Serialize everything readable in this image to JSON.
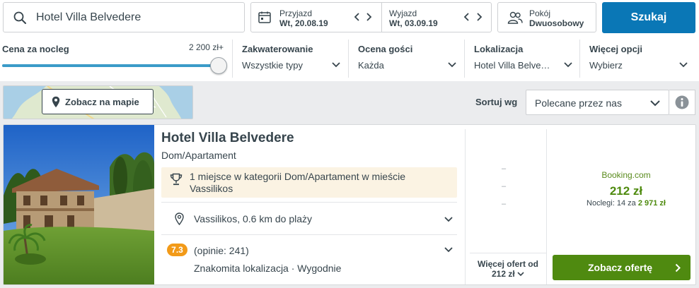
{
  "search": {
    "query": "Hotel Villa Belvedere",
    "button_label": "Szukaj",
    "icon": "search-icon"
  },
  "dates": {
    "checkin_label": "Przyjazd",
    "checkin_value": "Wt, 20.08.19",
    "checkout_label": "Wyjazd",
    "checkout_value": "Wt, 03.09.19"
  },
  "rooms": {
    "label": "Pokój",
    "value": "Dwuosobowy"
  },
  "filters": {
    "price": {
      "title": "Cena za nocleg",
      "max_label": "2 200 zł+",
      "fill": 1.0
    },
    "accommodation": {
      "title": "Zakwaterowanie",
      "value": "Wszystkie typy"
    },
    "rating": {
      "title": "Ocena gości",
      "value": "Każda"
    },
    "location": {
      "title": "Lokalizacja",
      "value": "Hotel Villa Belve…"
    },
    "more": {
      "title": "Więcej opcji",
      "value": "Wybierz"
    }
  },
  "map": {
    "button_label": "Zobacz na mapie"
  },
  "sort": {
    "label": "Sortuj wg",
    "value": "Polecane przez nas"
  },
  "hotel": {
    "name": "Hotel Villa Belvedere",
    "type": "Dom/Apartament",
    "award": "1 miejsce w kategorii Dom/Apartament w mieście Vassilikos",
    "location": "Vassilikos, 0.6 km do plaży",
    "rating": "7.3",
    "reviews": "(opinie: 241)",
    "tags": "Znakomita lokalizacja · Wygodnie",
    "placeholders": [
      "–",
      "–",
      "–"
    ],
    "more_offers_line1": "Więcej ofert od",
    "more_offers_line2": "212 zł",
    "partner": "Booking.com",
    "price": "212 zł",
    "nights_prefix": "Noclegi: 14 za",
    "nights_total": "2 971 zł",
    "deal_button": "Zobacz ofertę"
  },
  "colors": {
    "accent": "#0a77b6",
    "deal": "#4f8a10",
    "rating_badge": "#f29a18",
    "slider": "#3b9bc8"
  }
}
